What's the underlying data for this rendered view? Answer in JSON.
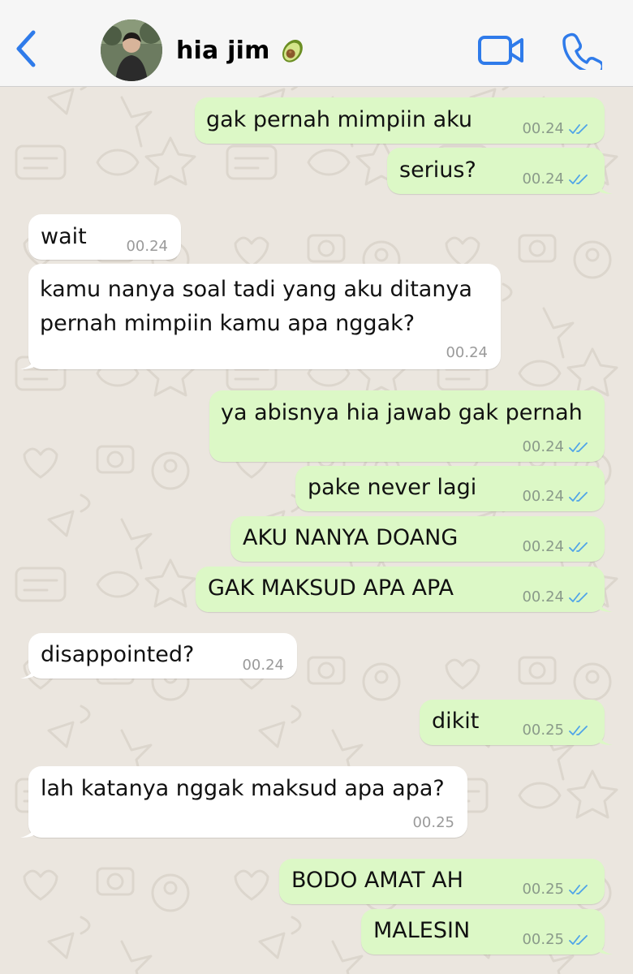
{
  "header": {
    "back_icon": "chevron-left-icon",
    "contact_name": "hia jim",
    "name_emoji_icon": "avocado-icon",
    "video_icon": "video-camera-icon",
    "call_icon": "phone-icon",
    "accent_color": "#2f7bea"
  },
  "colors": {
    "outgoing_bubble": "#dcf8c6",
    "incoming_bubble": "#ffffff",
    "read_ticks": "#4fa3e8",
    "wallpaper": "#ebe6df"
  },
  "messages": [
    {
      "direction": "out",
      "text": "gak pernah mimpiin aku",
      "time": "00.24",
      "status": "read"
    },
    {
      "direction": "out",
      "text": "serius?",
      "time": "00.24",
      "status": "read"
    },
    {
      "direction": "in",
      "text": "wait",
      "time": "00.24"
    },
    {
      "direction": "in",
      "text": "kamu nanya soal tadi yang aku ditanya\npernah mimpiin kamu apa nggak?",
      "time": "00.24"
    },
    {
      "direction": "out",
      "text": "ya abisnya hia jawab gak pernah",
      "time": "00.24",
      "status": "read"
    },
    {
      "direction": "out",
      "text": "pake never lagi",
      "time": "00.24",
      "status": "read"
    },
    {
      "direction": "out",
      "text": "AKU NANYA DOANG",
      "time": "00.24",
      "status": "read"
    },
    {
      "direction": "out",
      "text": "GAK MAKSUD APA APA",
      "time": "00.24",
      "status": "read"
    },
    {
      "direction": "in",
      "text": "disappointed?",
      "time": "00.24"
    },
    {
      "direction": "out",
      "text": "dikit",
      "time": "00.25",
      "status": "read"
    },
    {
      "direction": "in",
      "text": "lah katanya nggak maksud apa apa?",
      "time": "00.25"
    },
    {
      "direction": "out",
      "text": "BODO AMAT AH",
      "time": "00.25",
      "status": "read"
    },
    {
      "direction": "out",
      "text": "MALESIN",
      "time": "00.25",
      "status": "read"
    }
  ]
}
